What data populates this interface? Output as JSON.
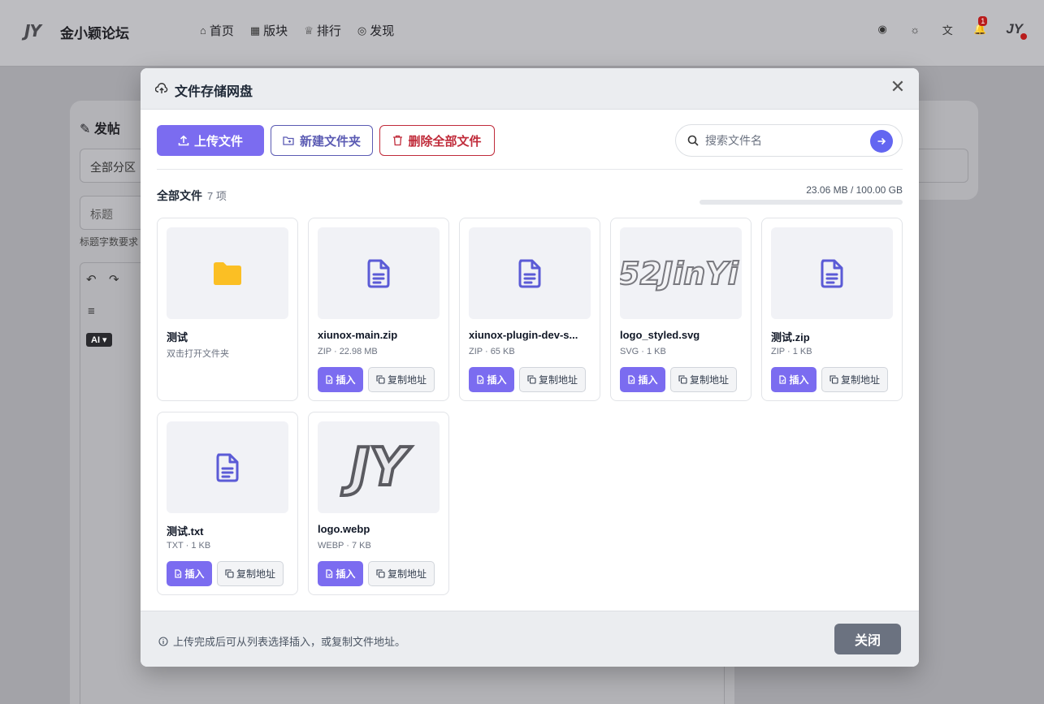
{
  "site": {
    "logo_text": "JY",
    "name": "金小颖论坛",
    "nav": [
      {
        "label": "首页",
        "icon": "home-icon"
      },
      {
        "label": "版块",
        "icon": "grid-icon"
      },
      {
        "label": "排行",
        "icon": "trophy-icon"
      },
      {
        "label": "发现",
        "icon": "compass-icon"
      }
    ],
    "notification_count": "1",
    "avatar_text": "JY"
  },
  "background": {
    "post_title": "发帖",
    "category_select": "全部分区",
    "title_placeholder": "标题",
    "title_hint": "标题字数要求",
    "ai_label": "AI"
  },
  "modal": {
    "title": "文件存储网盘",
    "upload_label": "上传文件",
    "new_folder_label": "新建文件夹",
    "delete_all_label": "删除全部文件",
    "search_placeholder": "搜索文件名",
    "all_files_label": "全部文件",
    "item_count": "7 项",
    "storage_text": "23.06 MB / 100.00 GB",
    "storage_used_fraction": 0.0002,
    "insert_label": "插入",
    "copy_label": "复制地址",
    "footer_note": "上传完成后可从列表选择插入，或复制文件地址。",
    "close_label": "关闭",
    "files": [
      {
        "name": "测试",
        "meta": "双击打开文件夹",
        "kind": "folder"
      },
      {
        "name": "xiunox-main.zip",
        "meta": "ZIP · 22.98 MB",
        "kind": "file"
      },
      {
        "name": "xiunox-plugin-dev-s...",
        "meta": "ZIP · 65 KB",
        "kind": "file"
      },
      {
        "name": "logo_styled.svg",
        "meta": "SVG · 1 KB",
        "kind": "image-52jinyi",
        "thumb_text": "52JinYi"
      },
      {
        "name": "测试.zip",
        "meta": "ZIP · 1 KB",
        "kind": "file"
      },
      {
        "name": "测试.txt",
        "meta": "TXT · 1 KB",
        "kind": "file"
      },
      {
        "name": "logo.webp",
        "meta": "WEBP · 7 KB",
        "kind": "image-jy",
        "thumb_text": "JY"
      }
    ]
  },
  "colors": {
    "accent": "#7b6cf0",
    "folder": "#fbbf24",
    "file_icon": "#5b5bd6",
    "danger": "#c02b3a"
  }
}
